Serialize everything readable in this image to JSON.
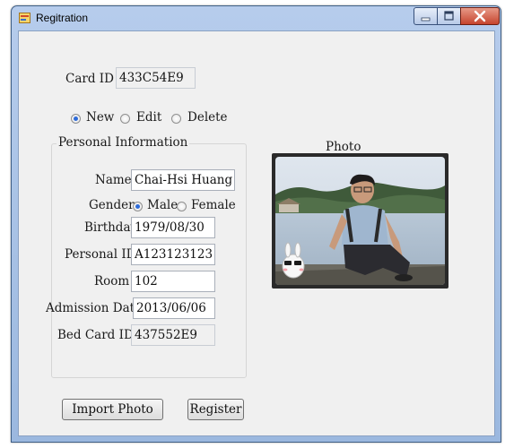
{
  "window": {
    "title": "Regitration"
  },
  "card": {
    "label": "Card ID",
    "value": "433C54E9"
  },
  "mode": {
    "options": [
      "New",
      "Edit",
      "Delete"
    ],
    "selected": "New"
  },
  "personal": {
    "group_title": "Personal Information",
    "name_label": "Name",
    "name_value": "Chai-Hsi Huang",
    "gender_label": "Gender",
    "gender_male": "Male",
    "gender_female": "Female",
    "gender_selected": "Male",
    "birthday_label": "Birthday",
    "birthday_value": "1979/08/30",
    "personal_id_label": "Personal ID",
    "personal_id_value": "A123123123",
    "room_label": "Room",
    "room_value": "102",
    "admission_label": "Admission Date",
    "admission_value": "2013/06/06",
    "bed_card_label": "Bed Card ID",
    "bed_card_value": "437552E9"
  },
  "photo": {
    "label": "Photo"
  },
  "buttons": {
    "import_photo": "Import Photo",
    "register": "Register"
  },
  "icons": {
    "app": "form-icon",
    "minimize": "minimize-icon",
    "maximize": "maximize-icon",
    "close": "close-icon"
  }
}
